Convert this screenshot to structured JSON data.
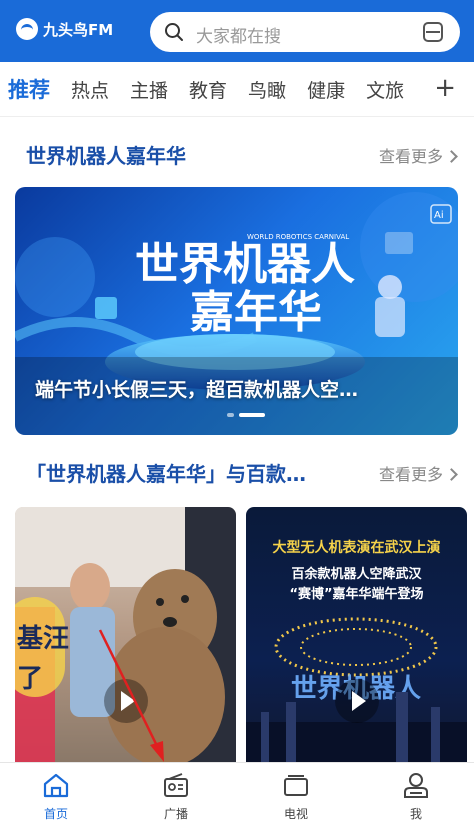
{
  "app": {
    "logo_text": "九头鸟FM"
  },
  "search": {
    "placeholder": "大家都在搜"
  },
  "tabs": [
    {
      "label": "推荐",
      "active": true
    },
    {
      "label": "热点"
    },
    {
      "label": "主播"
    },
    {
      "label": "教育"
    },
    {
      "label": "鸟瞰"
    },
    {
      "label": "健康"
    },
    {
      "label": "文旅"
    }
  ],
  "tab_add_symbol": "+",
  "section1": {
    "title": "世界机器人嘉年华",
    "more": "查看更多"
  },
  "banner": {
    "caption": "端午节小长假三天，超百款机器人空…",
    "art_title_line1": "世界机器人",
    "art_title_line2": "嘉年华",
    "art_subtitle": "WORLD ROBOTICS CARNIVAL",
    "art_ai_badge": "Ai"
  },
  "section2": {
    "title": "「世界机器人嘉年华」与百款…",
    "more": "查看更多"
  },
  "cards": [
    {
      "overlay_line1": "基汪",
      "overlay_line2": "了"
    },
    {
      "headline1": "大型无人机表演在武汉上演",
      "headline2": "百余款机器人空降武汉",
      "headline3": "“赛博”嘉年华端午登场",
      "art_text": "世界机器人"
    }
  ],
  "bottom_nav": [
    {
      "label": "首页",
      "icon": "home-icon",
      "active": true
    },
    {
      "label": "广播",
      "icon": "radio-icon"
    },
    {
      "label": "电视",
      "icon": "tv-icon"
    },
    {
      "label": "我",
      "icon": "profile-icon"
    }
  ],
  "colors": {
    "brand": "#1a6bd8",
    "section_title": "#1a4fa8",
    "annotation_arrow": "#e02020"
  }
}
